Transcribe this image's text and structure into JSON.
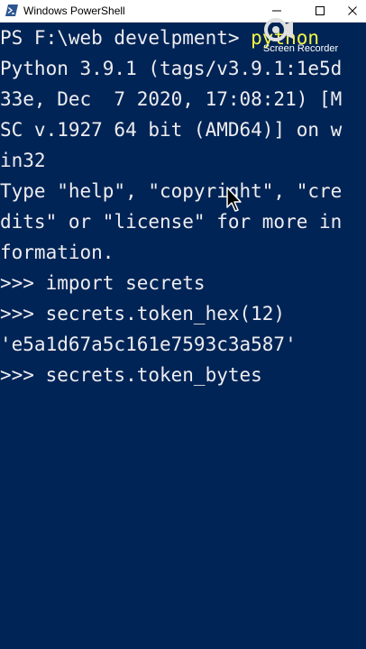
{
  "window": {
    "title": "Windows PowerShell",
    "minimize_glyph": "minimize-icon",
    "maximize_glyph": "maximize-icon",
    "close_glyph": "close-icon"
  },
  "console": {
    "background": "#012456",
    "text_color": "#eeedf0",
    "command_color": "#f5f543",
    "lines": [
      {
        "prompt": "PS F:\\web develpment> ",
        "command": "python"
      },
      {
        "text": "Python 3.9.1 (tags/v3.9.1:1e5d"
      },
      {
        "text": "33e, Dec  7 2020, 17:08:21) [M"
      },
      {
        "text": "SC v.1927 64 bit (AMD64)] on w"
      },
      {
        "text": "in32"
      },
      {
        "text": "Type \"help\", \"copyright\", \"cre"
      },
      {
        "text": "dits\" or \"license\" for more in"
      },
      {
        "text": "formation."
      },
      {
        "text": ">>> import secrets"
      },
      {
        "text": ">>> secrets.token_hex(12)"
      },
      {
        "text": "'e5a1d67a5c161e7593c3a587'"
      },
      {
        "text": ">>> secrets.token_bytes"
      }
    ]
  },
  "overlay": {
    "recorder_label": "Screen Recorder",
    "recorder_icon": "screen-recorder-logo-icon",
    "cursor_icon": "mouse-pointer-icon"
  }
}
